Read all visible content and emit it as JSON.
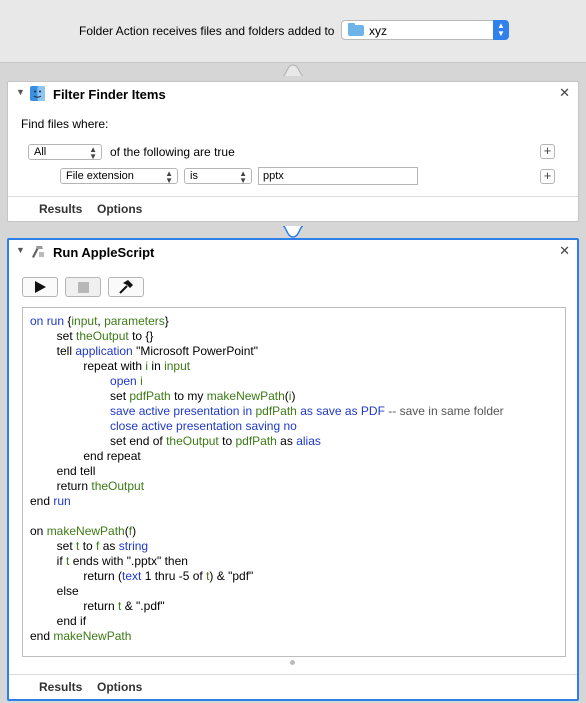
{
  "topbar": {
    "label": "Folder Action receives files and folders added to",
    "folder_value": "xyz"
  },
  "action1": {
    "title": "Filter Finder Items",
    "find_label": "Find files where:",
    "match_select": "All",
    "match_suffix": "of the following are true",
    "criteria_field": "File extension",
    "criteria_operator": "is",
    "criteria_value": "pptx",
    "footer_results": "Results",
    "footer_options": "Options"
  },
  "action2": {
    "title": "Run AppleScript",
    "footer_results": "Results",
    "footer_options": "Options",
    "code_lines": [
      [
        [
          "k",
          "on "
        ],
        [
          "k",
          "run"
        ],
        [
          "t",
          " {"
        ],
        [
          "v",
          "input"
        ],
        [
          "t",
          ", "
        ],
        [
          "v",
          "parameters"
        ],
        [
          "t",
          "}"
        ]
      ],
      [
        [
          "t",
          "\t"
        ],
        [
          "t",
          "set "
        ],
        [
          "v",
          "theOutput"
        ],
        [
          "t",
          " to {}"
        ]
      ],
      [
        [
          "t",
          "\t"
        ],
        [
          "t",
          "tell "
        ],
        [
          "k",
          "application"
        ],
        [
          "t",
          " \"Microsoft PowerPoint\""
        ]
      ],
      [
        [
          "t",
          "\t\t"
        ],
        [
          "t",
          "repeat with "
        ],
        [
          "v",
          "i"
        ],
        [
          "t",
          " in "
        ],
        [
          "v",
          "input"
        ]
      ],
      [
        [
          "t",
          "\t\t\t"
        ],
        [
          "k",
          "open"
        ],
        [
          "t",
          " "
        ],
        [
          "v",
          "i"
        ]
      ],
      [
        [
          "t",
          "\t\t\t"
        ],
        [
          "t",
          "set "
        ],
        [
          "v",
          "pdfPath"
        ],
        [
          "t",
          " to my "
        ],
        [
          "v",
          "makeNewPath"
        ],
        [
          "t",
          "("
        ],
        [
          "v",
          "i"
        ],
        [
          "t",
          ")"
        ]
      ],
      [
        [
          "t",
          "\t\t\t"
        ],
        [
          "k",
          "save"
        ],
        [
          "t",
          " "
        ],
        [
          "k",
          "active presentation"
        ],
        [
          "t",
          " "
        ],
        [
          "k",
          "in"
        ],
        [
          "t",
          " "
        ],
        [
          "v",
          "pdfPath"
        ],
        [
          "t",
          " "
        ],
        [
          "k",
          "as"
        ],
        [
          "t",
          " "
        ],
        [
          "k",
          "save as PDF"
        ],
        [
          "t",
          " "
        ],
        [
          "c",
          "-- save in same folder"
        ]
      ],
      [
        [
          "t",
          "\t\t\t"
        ],
        [
          "k",
          "close"
        ],
        [
          "t",
          " "
        ],
        [
          "k",
          "active presentation"
        ],
        [
          "t",
          " "
        ],
        [
          "k",
          "saving"
        ],
        [
          "t",
          " "
        ],
        [
          "k",
          "no"
        ]
      ],
      [
        [
          "t",
          "\t\t\t"
        ],
        [
          "t",
          "set end of "
        ],
        [
          "v",
          "theOutput"
        ],
        [
          "t",
          " to "
        ],
        [
          "v",
          "pdfPath"
        ],
        [
          "t",
          " as "
        ],
        [
          "k",
          "alias"
        ]
      ],
      [
        [
          "t",
          "\t\t"
        ],
        [
          "t",
          "end repeat"
        ]
      ],
      [
        [
          "t",
          "\t"
        ],
        [
          "t",
          "end tell"
        ]
      ],
      [
        [
          "t",
          "\t"
        ],
        [
          "t",
          "return "
        ],
        [
          "v",
          "theOutput"
        ]
      ],
      [
        [
          "t",
          "end "
        ],
        [
          "k",
          "run"
        ]
      ],
      [
        [
          "t",
          ""
        ]
      ],
      [
        [
          "t",
          "on "
        ],
        [
          "v",
          "makeNewPath"
        ],
        [
          "t",
          "("
        ],
        [
          "v",
          "f"
        ],
        [
          "t",
          ")"
        ]
      ],
      [
        [
          "t",
          "\t"
        ],
        [
          "t",
          "set "
        ],
        [
          "v",
          "t"
        ],
        [
          "t",
          " to "
        ],
        [
          "v",
          "f"
        ],
        [
          "t",
          " as "
        ],
        [
          "k",
          "string"
        ]
      ],
      [
        [
          "t",
          "\t"
        ],
        [
          "t",
          "if "
        ],
        [
          "v",
          "t"
        ],
        [
          "t",
          " ends with \".pptx\" then"
        ]
      ],
      [
        [
          "t",
          "\t\t"
        ],
        [
          "t",
          "return ("
        ],
        [
          "k",
          "text"
        ],
        [
          "t",
          " 1 thru -5 of "
        ],
        [
          "v",
          "t"
        ],
        [
          "t",
          ") & \"pdf\""
        ]
      ],
      [
        [
          "t",
          "\t"
        ],
        [
          "t",
          "else"
        ]
      ],
      [
        [
          "t",
          "\t\t"
        ],
        [
          "t",
          "return "
        ],
        [
          "v",
          "t"
        ],
        [
          "t",
          " & \".pdf\""
        ]
      ],
      [
        [
          "t",
          "\t"
        ],
        [
          "t",
          "end if"
        ]
      ],
      [
        [
          "t",
          "end "
        ],
        [
          "v",
          "makeNewPath"
        ]
      ]
    ]
  },
  "icons": {
    "folder": "folder-icon",
    "finder": "finder-icon",
    "script": "applescript-icon",
    "run": "play-icon",
    "stop": "stop-icon",
    "compile": "hammer-icon"
  },
  "colors": {
    "accent": "#2f7fe8",
    "keyword": "#1f38c8",
    "variable": "#3d7a16"
  }
}
